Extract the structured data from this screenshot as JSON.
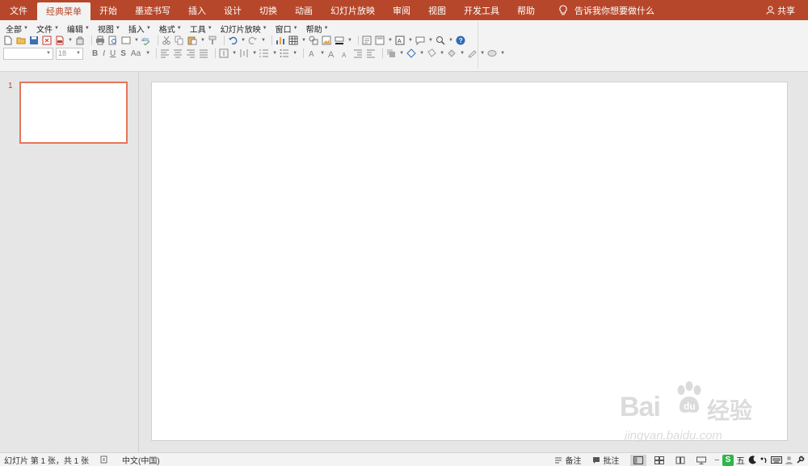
{
  "ribbon_tabs": [
    {
      "label": "文件"
    },
    {
      "label": "经典菜单"
    },
    {
      "label": "开始"
    },
    {
      "label": "墨迹书写"
    },
    {
      "label": "插入"
    },
    {
      "label": "设计"
    },
    {
      "label": "切换"
    },
    {
      "label": "动画"
    },
    {
      "label": "幻灯片放映"
    },
    {
      "label": "审阅"
    },
    {
      "label": "视图"
    },
    {
      "label": "开发工具"
    },
    {
      "label": "帮助"
    }
  ],
  "active_tab": "经典菜单",
  "tell_me": {
    "text": "告诉我你想要做什么",
    "icon": "lightbulb-icon"
  },
  "share": {
    "label": "共享",
    "icon": "person-icon"
  },
  "classic_menus": [
    {
      "label": "全部"
    },
    {
      "label": "文件"
    },
    {
      "label": "编辑"
    },
    {
      "label": "视图"
    },
    {
      "label": "插入"
    },
    {
      "label": "格式"
    },
    {
      "label": "工具"
    },
    {
      "label": "幻灯片放映"
    },
    {
      "label": "窗口"
    },
    {
      "label": "帮助"
    }
  ],
  "format_bar": {
    "font_name": "",
    "font_size": "18",
    "bold": "B",
    "italic": "I",
    "underline": "U",
    "strike": "S",
    "change_case": "Aa"
  },
  "thumbnails": [
    {
      "number": "1"
    }
  ],
  "watermark": {
    "brand": "Bai",
    "brand2": "经验",
    "url": "jingyan.baidu.com"
  },
  "status": {
    "slide_info": "幻灯片 第 1 张，共 1 张",
    "language": "中文(中国)",
    "notes": "备注",
    "comments": "批注",
    "ime_logo": "S",
    "ime_mode": "五"
  },
  "colors": {
    "accent": "#b7472a",
    "thumbnail_border": "#e8755a",
    "ime_green": "#2fb54a"
  }
}
